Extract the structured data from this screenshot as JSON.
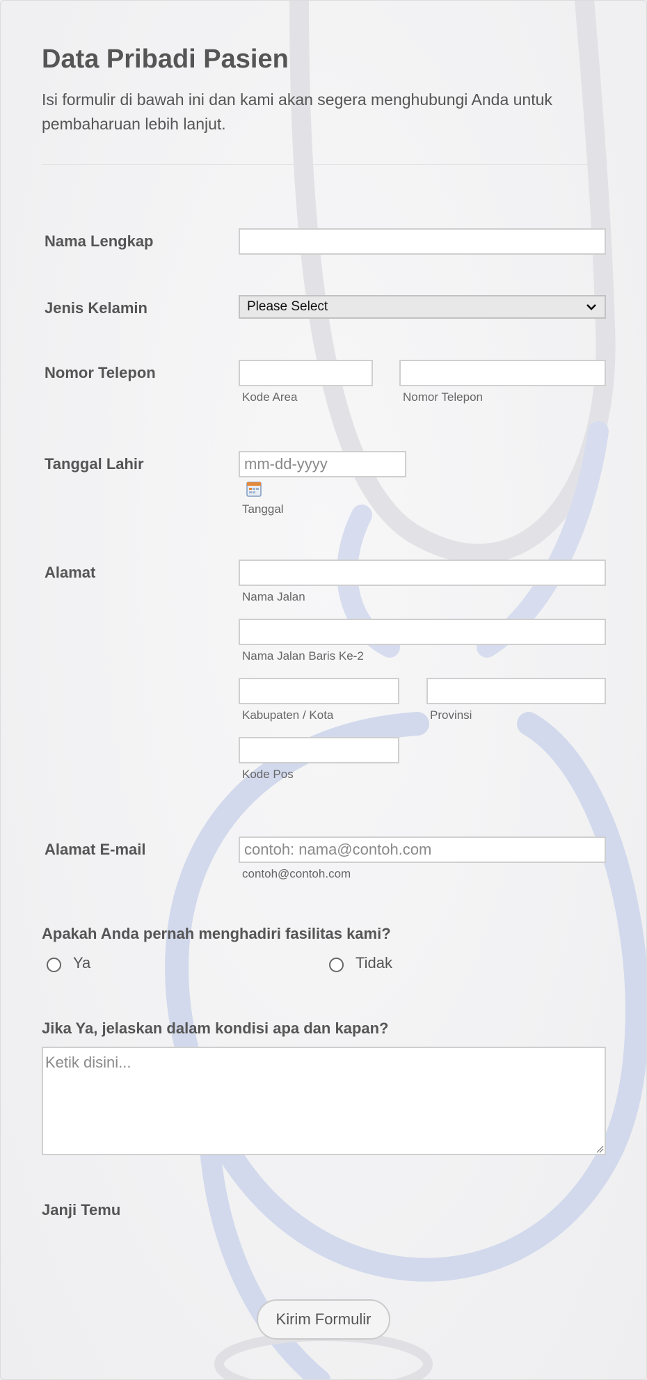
{
  "form": {
    "title": "Data Pribadi Pasien",
    "subtitle": "Isi formulir di bawah ini dan kami akan segera menghubungi Anda untuk pembaharuan lebih lanjut."
  },
  "fields": {
    "full_name": {
      "label": "Nama Lengkap",
      "value": ""
    },
    "gender": {
      "label": "Jenis Kelamin",
      "selected": "Please Select"
    },
    "phone": {
      "label": "Nomor Telepon",
      "area_sublabel": "Kode Area",
      "number_sublabel": "Nomor Telepon"
    },
    "birth_date": {
      "label": "Tanggal Lahir",
      "placeholder": "mm-dd-yyyy",
      "sublabel": "Tanggal"
    },
    "address": {
      "label": "Alamat",
      "street_sublabel": "Nama Jalan",
      "street2_sublabel": "Nama Jalan Baris Ke-2",
      "city_sublabel": "Kabupaten / Kota",
      "province_sublabel": "Provinsi",
      "postal_sublabel": "Kode Pos"
    },
    "email": {
      "label": "Alamat E-mail",
      "placeholder": "contoh: nama@contoh.com",
      "sublabel": "contoh@contoh.com"
    },
    "visited": {
      "question": "Apakah Anda pernah menghadiri fasilitas kami?",
      "options": [
        "Ya",
        "Tidak"
      ]
    },
    "details": {
      "question": "Jika Ya, jelaskan dalam kondisi apa dan kapan?",
      "placeholder": "Ketik disini..."
    },
    "appointment": {
      "label": "Janji Temu"
    }
  },
  "submit": {
    "label": "Kirim Formulir"
  },
  "icons": {
    "dropdown": "chevron-down-icon",
    "calendar": "calendar-icon",
    "resize": "resize-handle-icon"
  },
  "colors": {
    "text": "#555555",
    "input_border": "#cfcfcf",
    "select_bg": "#e8e8e8"
  }
}
